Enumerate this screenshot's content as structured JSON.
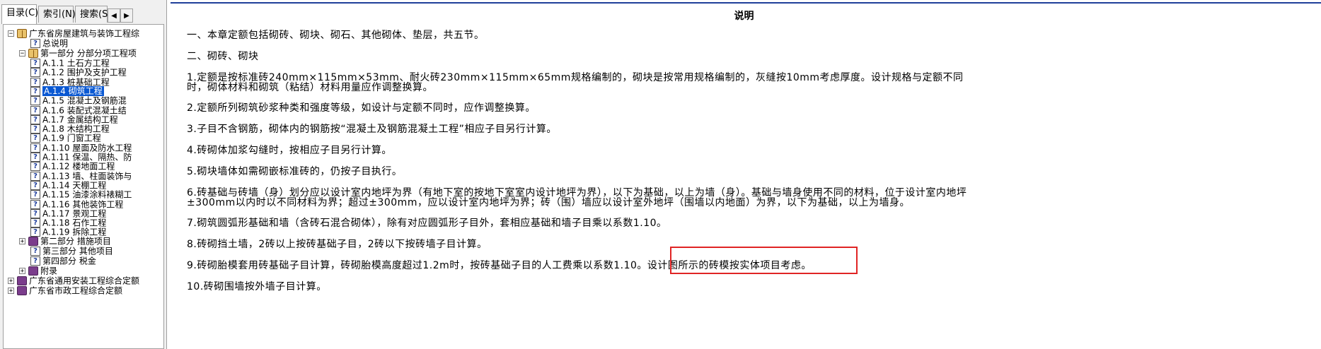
{
  "left_panel": {
    "tabs": [
      {
        "label": "目录(C)",
        "active": true
      },
      {
        "label": "索引(N)",
        "active": false
      },
      {
        "label": "搜索(S)",
        "active": false
      }
    ],
    "nav": {
      "prev": "◀",
      "next": "▶"
    },
    "tree": {
      "root": "广东省房屋建筑与装饰工程综",
      "general": "总说明",
      "part1": "第一部分 分部分项工程项",
      "chapters": [
        "A.1.1 土石方工程",
        "A.1.2 围护及支护工程",
        "A.1.3 桩基础工程",
        "A.1.4 砌筑工程",
        "A.1.5 混凝土及钢筋混",
        "A.1.6 装配式混凝土结",
        "A.1.7 金属结构工程",
        "A.1.8 木结构工程",
        "A.1.9 门窗工程",
        "A.1.10 屋面及防水工程",
        "A.1.11 保温、隔热、防",
        "A.1.12 楼地面工程",
        "A.1.13 墙、柱面装饰与",
        "A.1.14 天棚工程",
        "A.1.15 油漆涂料裱糊工",
        "A.1.16 其他装饰工程",
        "A.1.17 景观工程",
        "A.1.18 石作工程",
        "A.1.19 拆除工程"
      ],
      "part2": "第二部分 措施项目",
      "part3": "第三部分 其他项目",
      "part4": "第四部分 税金",
      "appendix": "附录",
      "other1": "广东省通用安装工程综合定额",
      "other2": "广东省市政工程综合定额"
    }
  },
  "document": {
    "title": "说明",
    "paragraphs": [
      "一、本章定额包括砌砖、砌块、砌石、其他砌体、垫层，共五节。",
      "二、砌砖、砌块",
      "1.定额是按标准砖240mm×115mm×53mm、耐火砖230mm×115mm×65mm规格编制的，砌块是按常用规格编制的，灰缝按10mm考虑厚度。设计规格与定额不同时，砌体材料和砌筑（粘结）材料用量应作调整换算。",
      "2.定额所列砌筑砂浆种类和强度等级，如设计与定额不同时，应作调整换算。",
      "3.子目不含钢筋，砌体内的钢筋按“混凝土及钢筋混凝土工程”相应子目另行计算。",
      "4.砖砌体加浆勾缝时，按相应子目另行计算。",
      "5.砌块墙体如需砌嵌标准砖的，仍按子目执行。",
      "6.砖基础与砖墙（身）划分应以设计室内地坪为界（有地下室的按地下室室内设计地坪为界），以下为基础，以上为墙（身）。基础与墙身使用不同的材料，位于设计室内地坪±300mm以内时以不同材料为界；超过±300mm，应以设计室内地坪为界；砖（围）墙应以设计室外地坪（围墙以内地面）为界，以下为基础，以上为墙身。",
      "7.砌筑圆弧形基础和墙（含砖石混合砌体），除有对应圆弧形子目外，套相应基础和墙子目乘以系数1.10。",
      "8.砖砌挡土墙，2砖以上按砖基础子目，2砖以下按砖墙子目计算。",
      "9.砖砌胎模套用砖基础子目计算，砖砌胎模高度超过1.2m时，按砖基础子目的人工费乘以系数1.10。设计图所示的砖模按实体项目考虑。",
      "10.砖砌围墙按外墙子目计算。"
    ]
  },
  "colors": {
    "selection": "#0a58d2",
    "highlight_box": "#e02424",
    "top_rule": "#1f3f9a"
  }
}
